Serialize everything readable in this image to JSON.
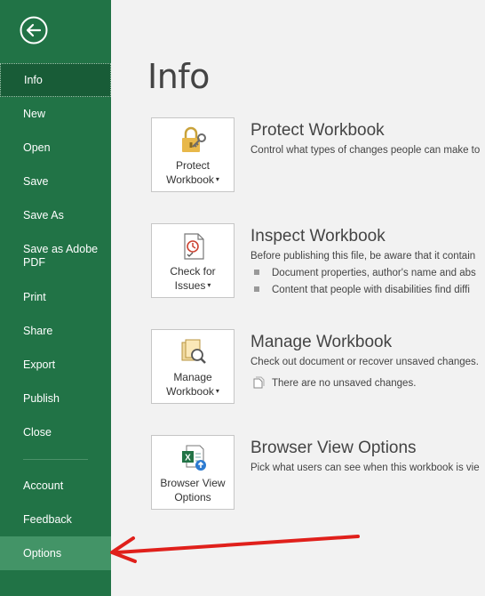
{
  "sidebar": {
    "items": [
      {
        "label": "Info"
      },
      {
        "label": "New"
      },
      {
        "label": "Open"
      },
      {
        "label": "Save"
      },
      {
        "label": "Save As"
      },
      {
        "label": "Save as Adobe PDF"
      },
      {
        "label": "Print"
      },
      {
        "label": "Share"
      },
      {
        "label": "Export"
      },
      {
        "label": "Publish"
      },
      {
        "label": "Close"
      },
      {
        "label": "Account"
      },
      {
        "label": "Feedback"
      },
      {
        "label": "Options"
      }
    ]
  },
  "main": {
    "title": "Info",
    "sections": [
      {
        "button_line1": "Protect",
        "button_line2": "Workbook",
        "title": "Protect Workbook",
        "description": "Control what types of changes people can make to"
      },
      {
        "button_line1": "Check for",
        "button_line2": "Issues",
        "title": "Inspect Workbook",
        "description": "Before publishing this file, be aware that it contain",
        "bullets": [
          "Document properties, author's name and abs",
          "Content that people with disabilities find diffi"
        ]
      },
      {
        "button_line1": "Manage",
        "button_line2": "Workbook",
        "title": "Manage Workbook",
        "description": "Check out document or recover unsaved changes.",
        "note": "There are no unsaved changes."
      },
      {
        "button_line1": "Browser View",
        "button_line2": "Options",
        "title": "Browser View Options",
        "description": "Pick what users can see when this workbook is vie"
      }
    ]
  },
  "colors": {
    "sidebar": "#217346",
    "active": "#185c37",
    "options_hover": "#439467",
    "arrow": "#e0201b"
  }
}
